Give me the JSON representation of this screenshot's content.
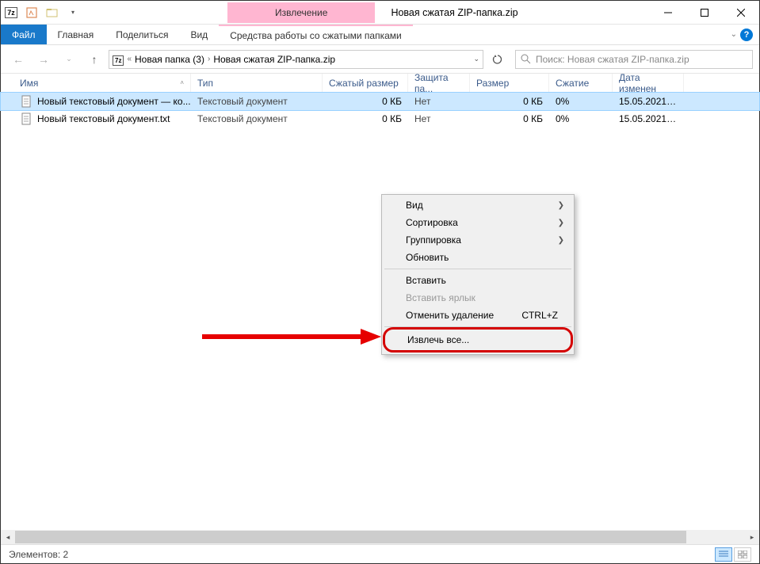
{
  "titlebar": {
    "ctx_tab": "Извлечение",
    "title": "Новая сжатая ZIP-папка.zip"
  },
  "ribbon": {
    "file": "Файл",
    "home": "Главная",
    "share": "Поделиться",
    "view": "Вид",
    "ctx": "Средства работы со сжатыми папками"
  },
  "address": {
    "root": "Новая папка (3)",
    "current": "Новая сжатая ZIP-папка.zip"
  },
  "search": {
    "placeholder": "Поиск: Новая сжатая ZIP-папка.zip"
  },
  "columns": {
    "name": "Имя",
    "type": "Тип",
    "csize": "Сжатый размер",
    "prot": "Защита па...",
    "size": "Размер",
    "comp": "Сжатие",
    "date": "Дата изменен"
  },
  "files": [
    {
      "name": "Новый текстовый документ — ко...",
      "type": "Текстовый документ",
      "csize": "0 КБ",
      "prot": "Нет",
      "size": "0 КБ",
      "comp": "0%",
      "date": "15.05.2021 14:",
      "selected": true
    },
    {
      "name": "Новый текстовый документ.txt",
      "type": "Текстовый документ",
      "csize": "0 КБ",
      "prot": "Нет",
      "size": "0 КБ",
      "comp": "0%",
      "date": "15.05.2021 14:",
      "selected": false
    }
  ],
  "context_menu": {
    "view": "Вид",
    "sort": "Сортировка",
    "group": "Группировка",
    "refresh": "Обновить",
    "paste": "Вставить",
    "paste_shortcut": "Вставить ярлык",
    "undo_delete": "Отменить удаление",
    "undo_shortcut": "CTRL+Z",
    "extract_all": "Извлечь все..."
  },
  "status": {
    "count_label": "Элементов: 2"
  }
}
